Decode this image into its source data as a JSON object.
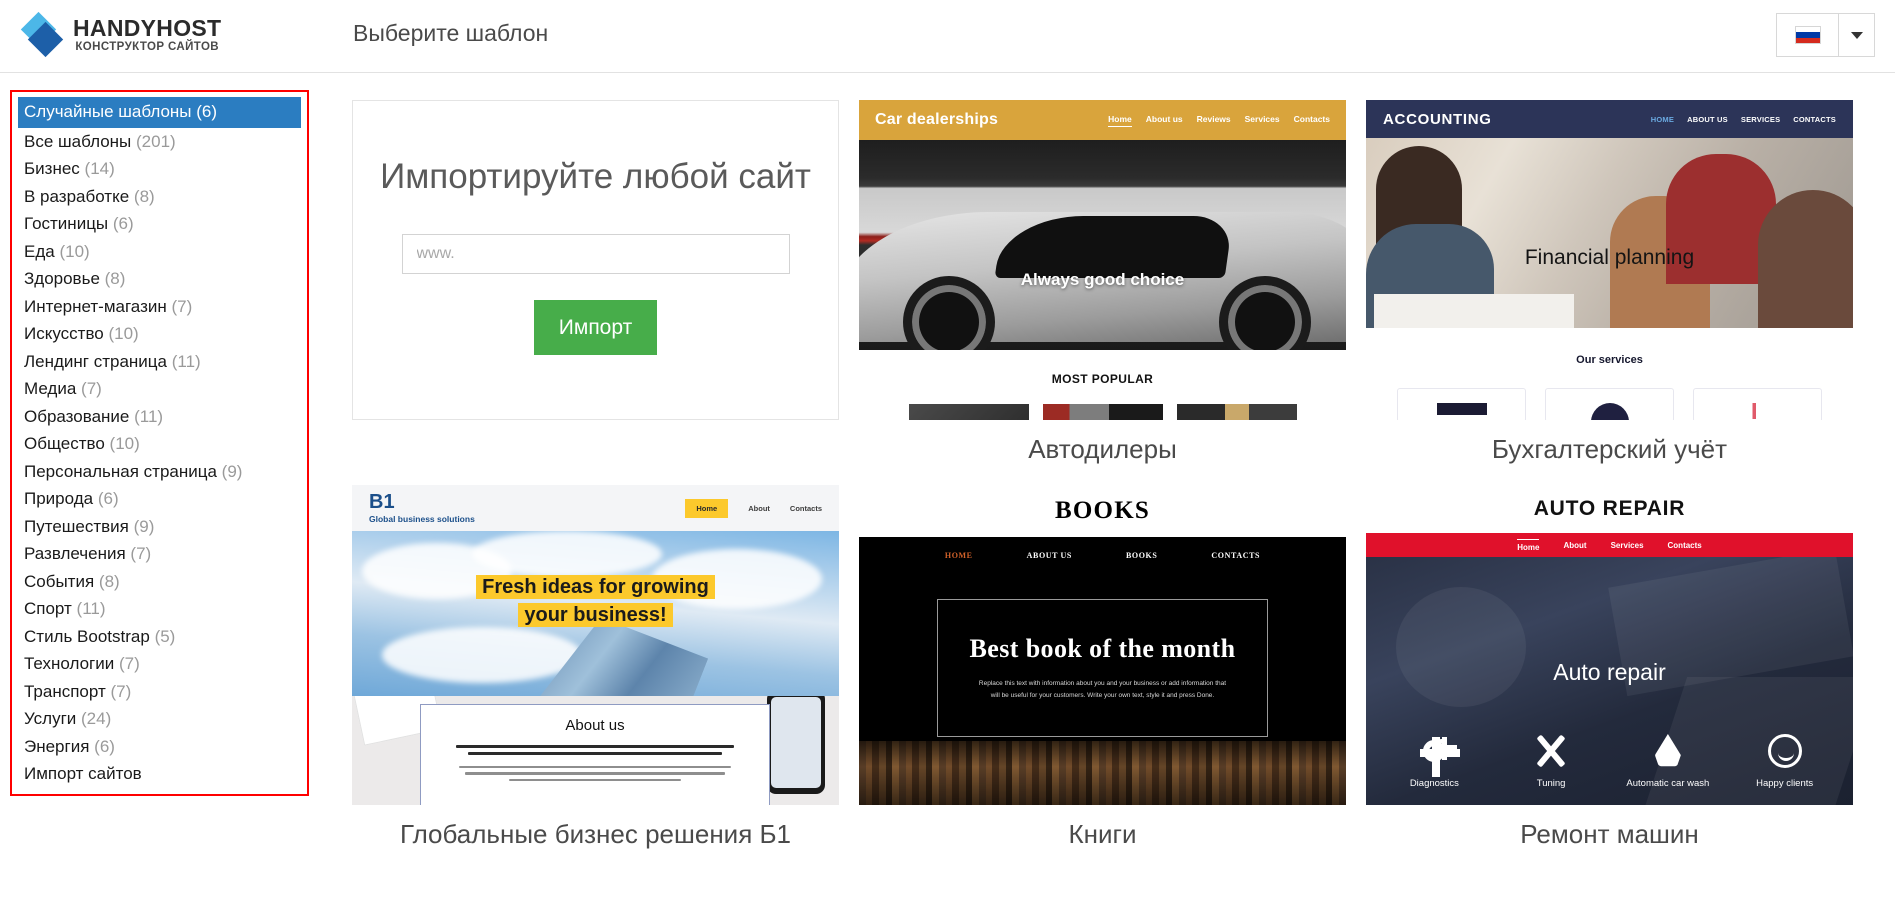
{
  "header": {
    "logo_main": "HANDYHOST",
    "logo_sub": "КОНСТРУКТОР САЙТОВ",
    "page_title": "Выберите шаблон",
    "language": "Русский",
    "flag_icon": "russia-flag-icon",
    "caret_icon": "chevron-down-icon"
  },
  "sidebar": {
    "items": [
      {
        "label": "Случайные шаблоны",
        "count": "(6)",
        "active": true
      },
      {
        "label": "Все шаблоны",
        "count": "(201)",
        "active": false
      },
      {
        "label": "Бизнес",
        "count": "(14)",
        "active": false
      },
      {
        "label": "В разработке",
        "count": "(8)",
        "active": false
      },
      {
        "label": "Гостиницы",
        "count": "(6)",
        "active": false
      },
      {
        "label": "Еда",
        "count": "(10)",
        "active": false
      },
      {
        "label": "Здоровье",
        "count": "(8)",
        "active": false
      },
      {
        "label": "Интернет-магазин",
        "count": "(7)",
        "active": false
      },
      {
        "label": "Искусство",
        "count": "(10)",
        "active": false
      },
      {
        "label": "Лендинг страница",
        "count": "(11)",
        "active": false
      },
      {
        "label": "Медиа",
        "count": "(7)",
        "active": false
      },
      {
        "label": "Образование",
        "count": "(11)",
        "active": false
      },
      {
        "label": "Общество",
        "count": "(10)",
        "active": false
      },
      {
        "label": "Персональная страница",
        "count": "(9)",
        "active": false
      },
      {
        "label": "Природа",
        "count": "(6)",
        "active": false
      },
      {
        "label": "Путешествия",
        "count": "(9)",
        "active": false
      },
      {
        "label": "Развлечения",
        "count": "(7)",
        "active": false
      },
      {
        "label": "События",
        "count": "(8)",
        "active": false
      },
      {
        "label": "Спорт",
        "count": "(11)",
        "active": false
      },
      {
        "label": "Стиль Bootstrap",
        "count": "(5)",
        "active": false
      },
      {
        "label": "Технологии",
        "count": "(7)",
        "active": false
      },
      {
        "label": "Транспорт",
        "count": "(7)",
        "active": false
      },
      {
        "label": "Услуги",
        "count": "(24)",
        "active": false
      },
      {
        "label": "Энергия",
        "count": "(6)",
        "active": false
      },
      {
        "label": "Импорт сайтов",
        "count": "",
        "active": false
      }
    ]
  },
  "import_card": {
    "title": "Импортируйте любой сайт",
    "input_placeholder": "www.",
    "input_value": "",
    "button_label": "Импорт"
  },
  "templates": {
    "car_dealership": {
      "caption": "Автодилеры",
      "logo": "Car dealerships",
      "nav": [
        "Home",
        "About us",
        "Reviews",
        "Services",
        "Contacts"
      ],
      "hero_text": "Always good choice",
      "section_title": "MOST POPULAR"
    },
    "accounting": {
      "caption": "Бухгалтерский учёт",
      "logo": "ACCOUNTING",
      "nav": [
        "HOME",
        "ABOUT US",
        "SERVICES",
        "CONTACTS"
      ],
      "hero_text": "Financial planning",
      "section_title": "Our services"
    },
    "b1": {
      "caption": "Глобальные бизнес решения Б1",
      "logo": "B1",
      "logo_sub": "Global business solutions",
      "nav": [
        "Home",
        "About",
        "Contacts"
      ],
      "hero_line1": "Fresh ideas for growing",
      "hero_line2": "your business!",
      "about_title": "About us"
    },
    "books": {
      "caption": "Книги",
      "logo": "BOOKS",
      "nav": [
        "HOME",
        "ABOUT US",
        "BOOKS",
        "CONTACTS"
      ],
      "hero_text": "Best book of the month",
      "hero_body": "Replace this text with information about you and your business or add information that will be useful for your customers. Write your own text, style it and press Done."
    },
    "auto_repair": {
      "caption": "Ремонт машин",
      "logo": "AUTO REPAIR",
      "nav": [
        "Home",
        "About",
        "Services",
        "Contacts"
      ],
      "hero_text": "Auto repair",
      "features": [
        {
          "label": "Diagnostics",
          "icon": "gears-icon"
        },
        {
          "label": "Tuning",
          "icon": "tools-icon"
        },
        {
          "label": "Automatic car wash",
          "icon": "water-drop-icon"
        },
        {
          "label": "Happy clients",
          "icon": "smiley-face-icon"
        }
      ]
    }
  },
  "colors": {
    "accent_blue": "#2b7dc1",
    "highlight_red": "#ff0000",
    "import_green": "#47ad4a",
    "car_header": "#d9a43c",
    "accounting_header": "#2c3458",
    "b1_yellow": "#fcc92c",
    "autorepair_red": "#e0112b"
  }
}
